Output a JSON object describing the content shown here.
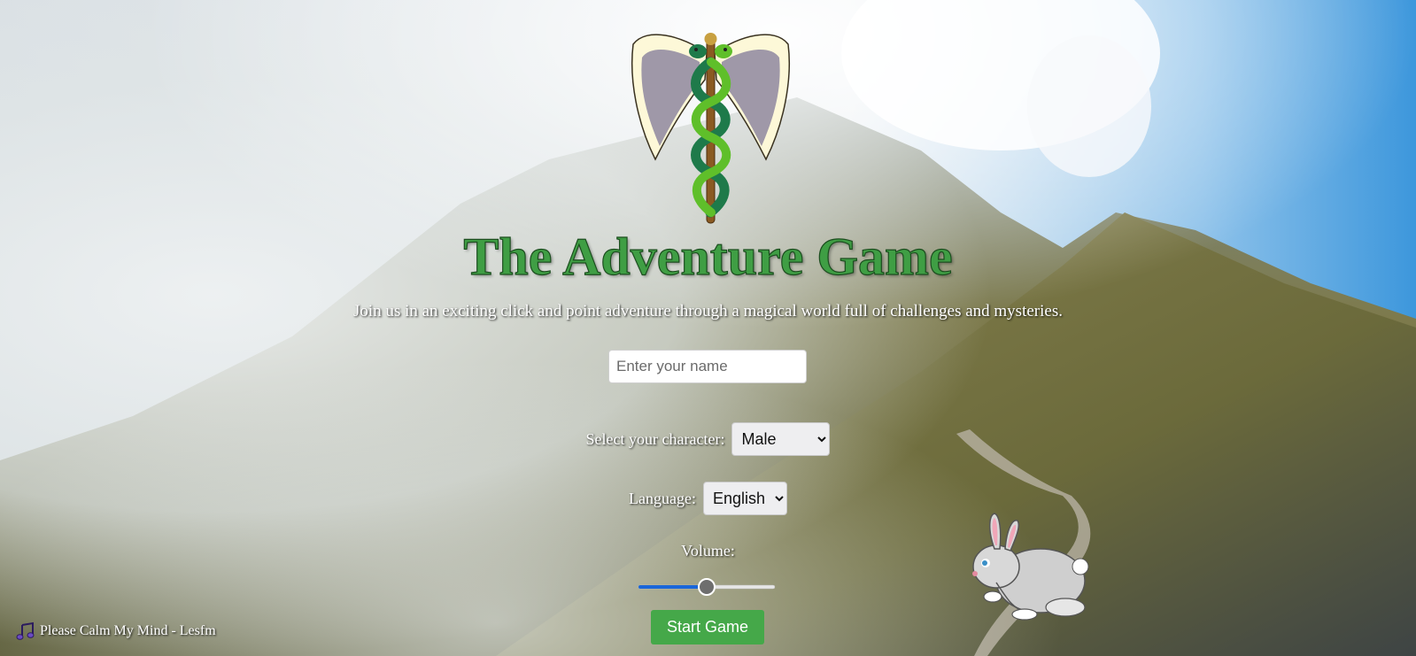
{
  "title": "The Adventure Game",
  "subtitle": "Join us in an exciting click and point adventure through a magical world full of challenges and mysteries.",
  "name_input": {
    "value": "",
    "placeholder": "Enter your name"
  },
  "character": {
    "label": "Select your character:",
    "selected": "Male"
  },
  "language": {
    "label": "Language:",
    "selected": "English"
  },
  "volume": {
    "label": "Volume:",
    "level_percent": 50
  },
  "start_button": "Start Game",
  "music": {
    "icon": "music-note-icon",
    "track": "Please Calm My Mind - Lesfm"
  },
  "colors": {
    "title_green": "#3f9e44",
    "button_green": "#45a849",
    "slider_blue": "#1a66d9"
  }
}
